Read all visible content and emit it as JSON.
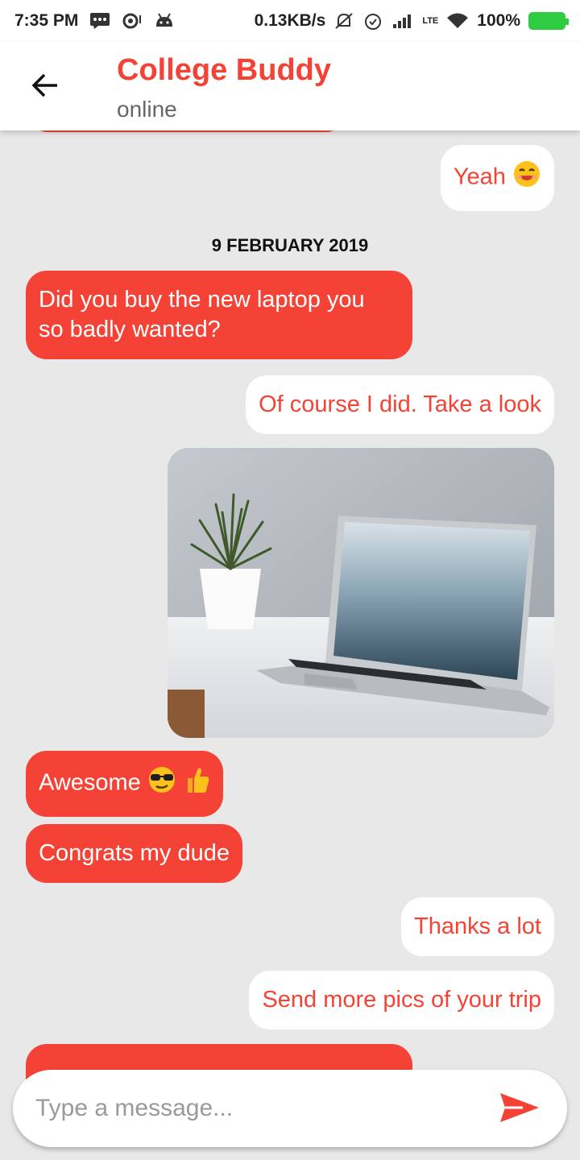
{
  "status_bar": {
    "time": "7:35 PM",
    "network_speed": "0.13KB/s",
    "network_type": "LTE",
    "battery": "100%",
    "icons": [
      "message-icon",
      "sync-icon",
      "android-icon",
      "mute-icon",
      "alarm-icon",
      "signal-icon",
      "wifi-icon",
      "battery-charging-icon"
    ]
  },
  "header": {
    "title": "College Buddy",
    "subtitle": "online",
    "back_icon": "arrow-back-icon"
  },
  "chat": {
    "messages": [
      {
        "direction": "outgoing",
        "text": "Yeah",
        "emoji": "smiling-face-emoji"
      },
      {
        "type": "date",
        "text": "9 FEBRUARY 2019"
      },
      {
        "direction": "incoming",
        "text": "Did you buy the new laptop you so badly wanted?",
        "line1": "Did you buy the new laptop you",
        "line2": "so badly wanted?"
      },
      {
        "direction": "outgoing",
        "text": "Of course I did. Take a look"
      },
      {
        "direction": "outgoing",
        "type": "image",
        "content": "laptop-photo"
      },
      {
        "direction": "incoming",
        "text": "Awesome",
        "emoji": "sunglasses-thumbs-up-emoji"
      },
      {
        "direction": "incoming",
        "text": "Congrats my dude"
      },
      {
        "direction": "outgoing",
        "text": "Thanks a lot"
      },
      {
        "direction": "outgoing",
        "text": "Send more pics of your trip"
      }
    ]
  },
  "composer": {
    "placeholder": "Type a message...",
    "value": "",
    "send_icon": "send-icon"
  },
  "colors": {
    "accent": "#f44336",
    "chat_background": "#e8e8e8",
    "incoming_bubble": "#f44336",
    "outgoing_bubble": "#ffffff"
  }
}
